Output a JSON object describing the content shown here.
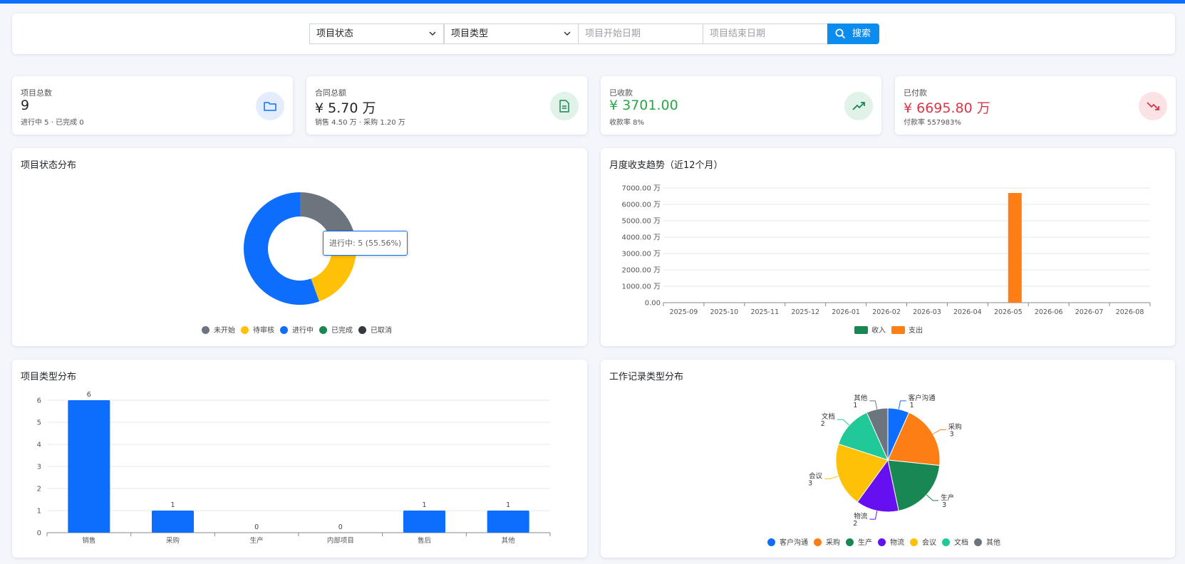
{
  "search": {
    "status_label": "项目状态",
    "type_label": "项目类型",
    "start_placeholder": "项目开始日期",
    "end_placeholder": "项目结束日期",
    "button_label": "搜索"
  },
  "stats": [
    {
      "label": "项目总数",
      "value": "9",
      "sub": "进行中 5 · 已完成 0",
      "icon": "folder-icon",
      "color": "#212529",
      "icon_color": "#0d6efd",
      "icon_bg": "#e3edfd"
    },
    {
      "label": "合同总额",
      "value": "¥ 5.70 万",
      "sub": "销售 4.50 万 · 采购 1.20 万",
      "icon": "document-icon",
      "color": "#212529",
      "icon_color": "#198754",
      "icon_bg": "#e1f2e8"
    },
    {
      "label": "已收款",
      "value": "¥ 3701.00",
      "sub": "收款率 8%",
      "icon": "trending-up-icon",
      "color": "#28a745",
      "icon_color": "#198754",
      "icon_bg": "#e1f2e8"
    },
    {
      "label": "已付款",
      "value": "¥ 6695.80 万",
      "sub": "付款率 557983%",
      "icon": "trending-down-icon",
      "color": "#dc3545",
      "icon_color": "#dc3545",
      "icon_bg": "#fbe3e5"
    }
  ],
  "panels": {
    "status_title": "项目状态分布",
    "trend_title": "月度收支趋势（近12个月）",
    "type_title": "项目类型分布",
    "work_title": "工作记录类型分布"
  },
  "tooltip": "进行中: 5 (55.56%)",
  "chart_data": [
    {
      "type": "pie",
      "title": "项目状态分布",
      "donut": true,
      "labels": [
        "未开始",
        "待审核",
        "进行中",
        "已完成",
        "已取消"
      ],
      "values": [
        2,
        2,
        5,
        0,
        0
      ],
      "colors": [
        "#6c757d",
        "#ffc107",
        "#0d6efd",
        "#198754",
        "#343a40"
      ],
      "legend": "bottom"
    },
    {
      "type": "bar",
      "title": "月度收支趋势（近12个月）",
      "categories": [
        "2025-09",
        "2025-10",
        "2025-11",
        "2025-12",
        "2026-01",
        "2026-02",
        "2026-03",
        "2026-04",
        "2026-05",
        "2026-06",
        "2026-07",
        "2026-08"
      ],
      "series": [
        {
          "name": "收入",
          "values": [
            0,
            0,
            0,
            0,
            0,
            0,
            0,
            0,
            0.37,
            0,
            0,
            0
          ],
          "color": "#198754"
        },
        {
          "name": "支出",
          "values": [
            0,
            0,
            0,
            0,
            0,
            0,
            0,
            0,
            6695.8,
            0,
            0,
            0
          ],
          "color": "#fd7e14"
        }
      ],
      "ylim": [
        0,
        7000
      ],
      "ytick_labels": [
        "0.00",
        "1000.00 万",
        "2000.00 万",
        "3000.00 万",
        "4000.00 万",
        "5000.00 万",
        "6000.00 万",
        "7000.00 万"
      ],
      "grid": true,
      "legend": "bottom"
    },
    {
      "type": "bar",
      "title": "项目类型分布",
      "categories": [
        "销售",
        "采购",
        "生产",
        "内部项目",
        "售后",
        "其他"
      ],
      "values": [
        6,
        1,
        0,
        0,
        1,
        1
      ],
      "color": "#0d6efd",
      "ylim": [
        0,
        6
      ],
      "grid": true
    },
    {
      "type": "pie",
      "title": "工作记录类型分布",
      "labels": [
        "客户沟通",
        "采购",
        "生产",
        "物流",
        "会议",
        "文档",
        "其他"
      ],
      "values": [
        1,
        3,
        3,
        2,
        3,
        2,
        1
      ],
      "colors": [
        "#0d6efd",
        "#fd7e14",
        "#198754",
        "#6610f2",
        "#ffc107",
        "#20c997",
        "#6c757d"
      ],
      "legend": "bottom"
    }
  ]
}
